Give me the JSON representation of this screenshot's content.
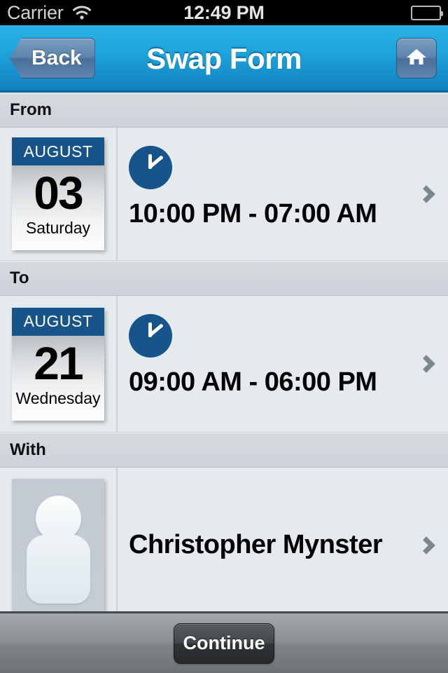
{
  "status_bar": {
    "carrier": "Carrier",
    "wifi_icon": "wifi-icon",
    "time": "12:49 PM",
    "battery_icon": "battery-icon"
  },
  "nav_bar": {
    "back_label": "Back",
    "title": "Swap Form",
    "home_icon": "home-icon"
  },
  "sections": {
    "from": {
      "header": "From",
      "calendar": {
        "month": "AUGUST",
        "day": "03",
        "weekday": "Saturday"
      },
      "clock_icon": "clock-icon",
      "time_range": "10:00 PM - 07:00 AM",
      "chevron_icon": "chevron-right-icon"
    },
    "to": {
      "header": "To",
      "calendar": {
        "month": "AUGUST",
        "day": "21",
        "weekday": "Wednesday"
      },
      "clock_icon": "clock-icon",
      "time_range": "09:00 AM - 06:00 PM",
      "chevron_icon": "chevron-right-icon"
    },
    "with": {
      "header": "With",
      "avatar_icon": "person-placeholder-icon",
      "person_name": "Christopher Mynster",
      "chevron_icon": "chevron-right-icon"
    }
  },
  "toolbar": {
    "continue_label": "Continue"
  },
  "colors": {
    "nav_blue": "#1ea3dc",
    "accent_dark_blue": "#17548a",
    "content_bg": "#e4eaed",
    "section_header_bg": "#ccd2d8",
    "chevron_gray": "#7d868c",
    "toolbar_gray": "#8d9194"
  }
}
